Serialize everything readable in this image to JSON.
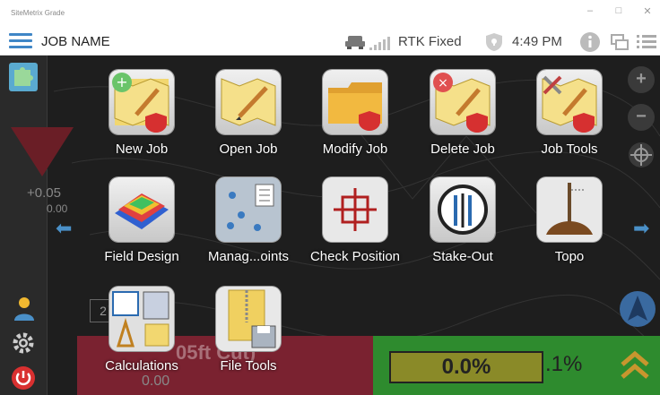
{
  "window": {
    "title": "SiteMetrix Grade"
  },
  "header": {
    "job_name": "JOB NAME",
    "gps_status": "RTK Fixed",
    "time": "4:49 PM"
  },
  "menu": {
    "tiles": [
      {
        "label": "New Job",
        "icon": "new-job-icon"
      },
      {
        "label": "Open Job",
        "icon": "open-job-icon"
      },
      {
        "label": "Modify Job",
        "icon": "folder-icon"
      },
      {
        "label": "Delete Job",
        "icon": "delete-job-icon"
      },
      {
        "label": "Job Tools",
        "icon": "job-tools-icon"
      },
      {
        "label": "Field Design",
        "icon": "field-design-icon"
      },
      {
        "label": "Manag...oints",
        "icon": "manage-points-icon"
      },
      {
        "label": "Check Position",
        "icon": "crosshair-icon"
      },
      {
        "label": "Stake-Out",
        "icon": "stake-out-icon"
      },
      {
        "label": "Topo",
        "icon": "topo-icon"
      },
      {
        "label": "Calculations",
        "icon": "calculations-icon"
      },
      {
        "label": "File Tools",
        "icon": "file-tools-icon"
      }
    ]
  },
  "background": {
    "cut_fill_value": "+0.05",
    "cut_fill_sub": "0.00",
    "bottom_left_label": "05ft Cut)",
    "bottom_left_value": "0.00",
    "grade_percent": "0.0%",
    "grade_percent_secondary": ".1%",
    "left_small_value": "2"
  },
  "colors": {
    "accent": "#3f86c6",
    "map_background": "#1e1e1e",
    "cut_panel": "#7a2230",
    "fill_panel": "#2e8b2e"
  }
}
